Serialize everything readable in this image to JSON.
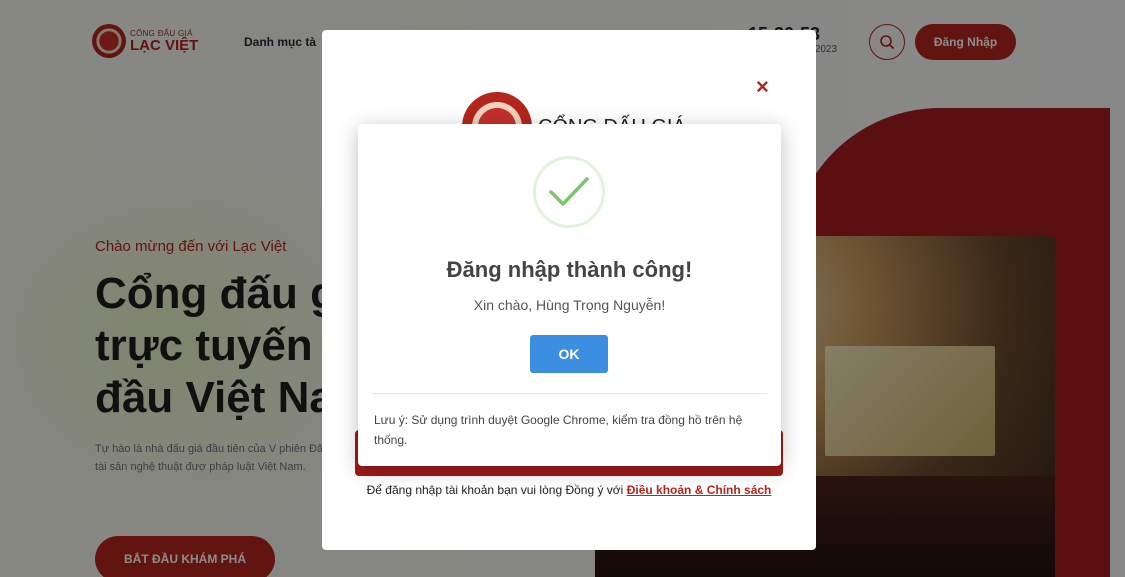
{
  "header": {
    "logo_top": "CỔNG ĐẤU GIÁ",
    "logo_bottom": "LẠC VIỆT",
    "nav_item": "Danh mục tà",
    "clock": "15:30:53",
    "date": "/2023",
    "login_label": "Đăng Nhập"
  },
  "hero": {
    "welcome": "Chào mừng đến với Lạc Việt",
    "title_line1": "Cổng đấu gi",
    "title_line2": "trực tuyến h",
    "title_line3": "đầu Việt Na",
    "description": "Tự hào là nhà đấu giá đầu tiên của V phiên Đấu giá tài sản nghệ thuật đượ pháp luật Việt Nam.",
    "explore_label": "BẮT ĐẦU KHÁM PHÁ"
  },
  "login_modal": {
    "close_symbol": "×",
    "title": "CỔNG ĐẤU GIÁ",
    "terms_prefix": "Để đăng nhập tài khoản bạn vui lòng Đồng ý với",
    "terms_link": "Điều khoản & Chính sách"
  },
  "success_dialog": {
    "title": "Đăng nhập thành công!",
    "message": "Xin chào, Hùng Trọng Nguyễn!",
    "ok_label": "OK",
    "note": "Lưu ý: Sử dụng trình duyệt Google Chrome, kiểm tra đồng hồ trên hệ thống."
  },
  "colors": {
    "brand_red": "#b3261e",
    "ok_blue": "#3b8ee0",
    "check_green": "#7cc66a"
  },
  "icons": [
    "search-icon",
    "close-icon",
    "check-icon"
  ]
}
